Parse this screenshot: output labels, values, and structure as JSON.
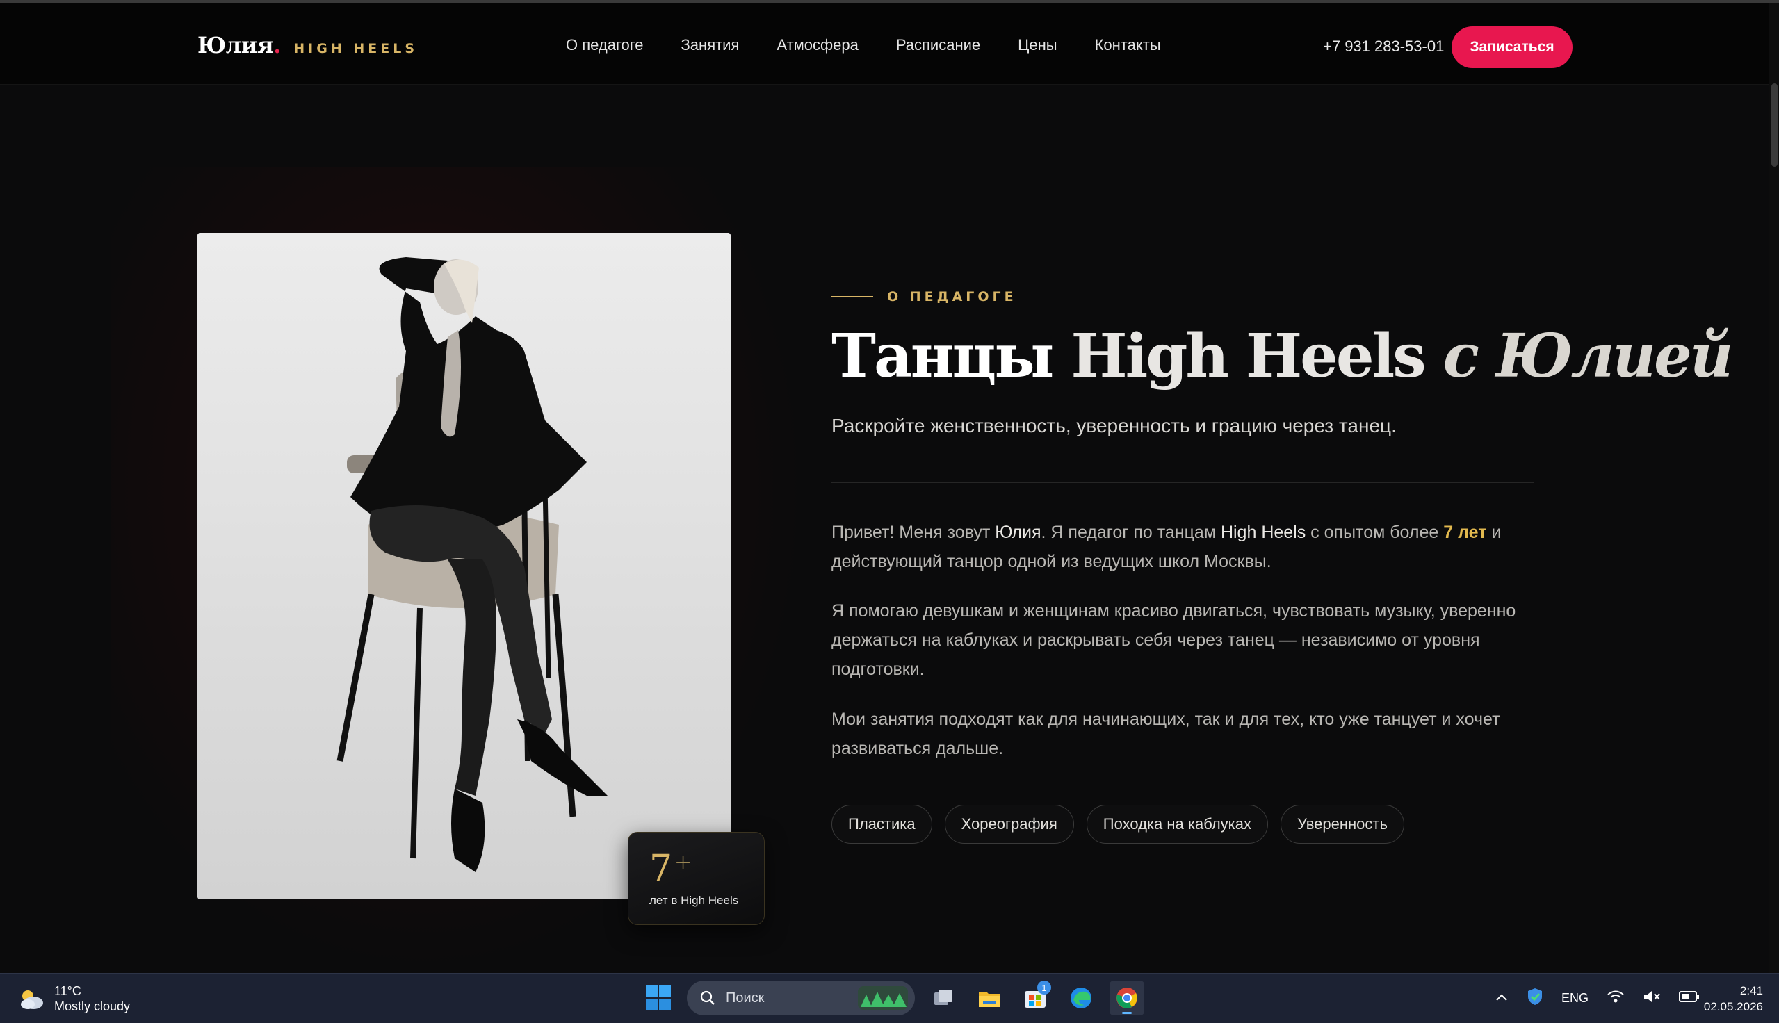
{
  "header": {
    "logo_name": "Юлия",
    "logo_dot": ".",
    "logo_sub": "HIGH HEELS",
    "nav": [
      "О педагоге",
      "Занятия",
      "Атмосфера",
      "Расписание",
      "Цены",
      "Контакты"
    ],
    "phone": "+7 931 283-53-01",
    "cta_label": "Записаться"
  },
  "hero": {
    "eyebrow": "О ПЕДАГОГЕ",
    "title_part1": "Танцы ",
    "title_part2": "High Heels",
    "title_part3": " с Юлией",
    "subtitle": "Раскройте женственность, уверенность и грацию через танец.",
    "para1": {
      "a": "Привет! Меня зовут ",
      "name": "Юлия",
      "b": ". Я педагог по танцам ",
      "style": "High Heels",
      "c": " с опытом более ",
      "years": "7 лет",
      "d": " и действующий танцор одной из ведущих школ Москвы."
    },
    "para2": "Я помогаю девушкам и женщинам красиво двигаться, чувствовать музыку, уверенно держаться на каблуках и раскрывать себя через танец — независимо от уровня подготовки.",
    "para3": "Мои занятия подходят как для начинающих, так и для тех, кто уже танцует и хочет развиваться дальше.",
    "tags": [
      "Пластика",
      "Хореография",
      "Походка на каблуках",
      "Уверенность"
    ],
    "badge": {
      "number": "7",
      "plus": "+",
      "text": "лет в High Heels"
    }
  },
  "taskbar": {
    "weather_temp": "11°C",
    "weather_desc": "Mostly cloudy",
    "search_placeholder": "Поиск",
    "store_badge": "1",
    "lang": "ENG",
    "time": "2:41",
    "date": "02.05.2026"
  },
  "colors": {
    "accent": "#e8174f",
    "gold": "#d8b566",
    "background": "#0b0b0c"
  }
}
